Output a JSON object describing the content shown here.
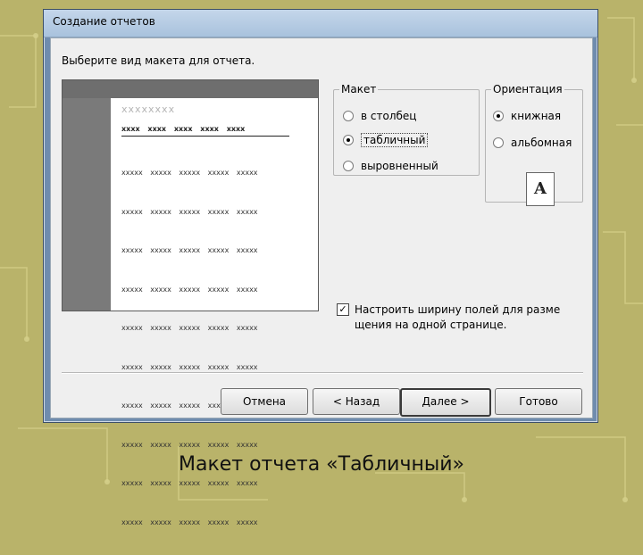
{
  "window": {
    "title": "Создание отчетов"
  },
  "prompt": "Выберите вид макета для отчета.",
  "preview": {
    "placeholder": "xxxxxxxx",
    "column_headers": "xxxx xxxx xxxx xxxx xxxx",
    "row_text": "xxxxx xxxxx xxxxx xxxxx xxxxx"
  },
  "layout_group": {
    "legend": "Макет",
    "options": [
      {
        "label": "в столбец",
        "selected": false
      },
      {
        "label": "табличный",
        "selected": true
      },
      {
        "label": "выровненный",
        "selected": false
      }
    ]
  },
  "orientation_group": {
    "legend": "Ориентация",
    "options": [
      {
        "label": "книжная",
        "selected": true
      },
      {
        "label": "альбомная",
        "selected": false
      }
    ],
    "icon_letter": "A"
  },
  "fit_checkbox": {
    "checked": true,
    "line1": "Настроить ширину полей для разме",
    "line2": "щения на одной странице."
  },
  "buttons": {
    "cancel": "Отмена",
    "back": "< Назад",
    "next": "Далее >",
    "finish": "Готово"
  },
  "caption": "Макет отчета «Табличный»",
  "colors": {
    "background": "#b9b36a",
    "dialog": "#efefef",
    "titlebar": "#a9c2dd"
  }
}
